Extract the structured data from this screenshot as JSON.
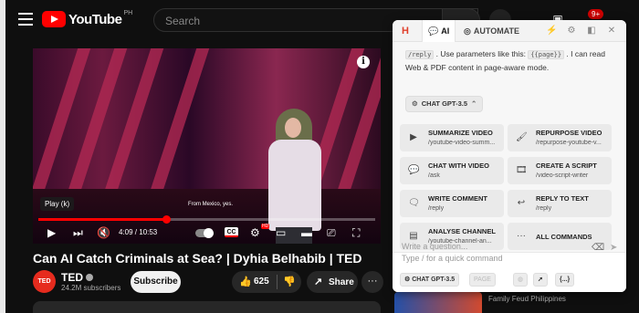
{
  "youtube": {
    "logo_text": "YouTube",
    "region": "PH",
    "search_placeholder": "Search",
    "notification_count": "9+"
  },
  "player": {
    "tooltip": "Play (k)",
    "caption": "From Mexico, yes.",
    "info_label": "i",
    "current_time": "4:09",
    "duration": "10:53",
    "time_display": "4:09 / 10:53",
    "progress_fraction": 0.38,
    "cc_label": "CC",
    "hd_label": "HD"
  },
  "video": {
    "title": "Can AI Catch Criminals at Sea? | Dyhia Belhabib | TED",
    "channel": "TED",
    "channel_avatar": "TED",
    "subscribers": "24.2M subscribers",
    "subscribe_label": "Subscribe",
    "likes": "625",
    "share_label": "Share",
    "more_label": "···"
  },
  "recommendation": {
    "channel": "Family Feud Philippines"
  },
  "panel": {
    "logo": "H",
    "tabs": [
      {
        "label": "AI",
        "icon": "chat-icon",
        "active": true
      },
      {
        "label": "AUTOMATE",
        "icon": "automate-icon",
        "active": false
      }
    ],
    "intro": {
      "cmd": "/reply",
      "text1": ". Use parameters like this:",
      "param": "{{page}}",
      "text2": ". I can read Web & PDF content in page-aware mode."
    },
    "model": "CHAT GPT-3.5",
    "commands": [
      {
        "title": "SUMMARIZE VIDEO",
        "path": "/youtube-video-summ...",
        "icon": "▶"
      },
      {
        "title": "REPURPOSE VIDEO",
        "path": "/repurpose-youtube-v...",
        "icon": "🖌"
      },
      {
        "title": "CHAT WITH VIDEO",
        "path": "/ask",
        "icon": "💬"
      },
      {
        "title": "CREATE A SCRIPT",
        "path": "/video-script-writer",
        "icon": "🎞"
      },
      {
        "title": "WRITE COMMENT",
        "path": "/reply",
        "icon": "🗨"
      },
      {
        "title": "REPLY TO TEXT",
        "path": "/reply",
        "icon": "↩"
      },
      {
        "title": "ANALYSE CHANNEL",
        "path": "/youtube-channel-an...",
        "icon": "▤"
      },
      {
        "title": "ALL COMMANDS",
        "path": "",
        "icon": "···"
      }
    ],
    "prompt_line1": "Write a question...",
    "prompt_line2": "Type / for a quick command",
    "footer_model": "CHAT GPT-3.5",
    "footer_page": "PAGE",
    "footer_braces": "{...}"
  }
}
